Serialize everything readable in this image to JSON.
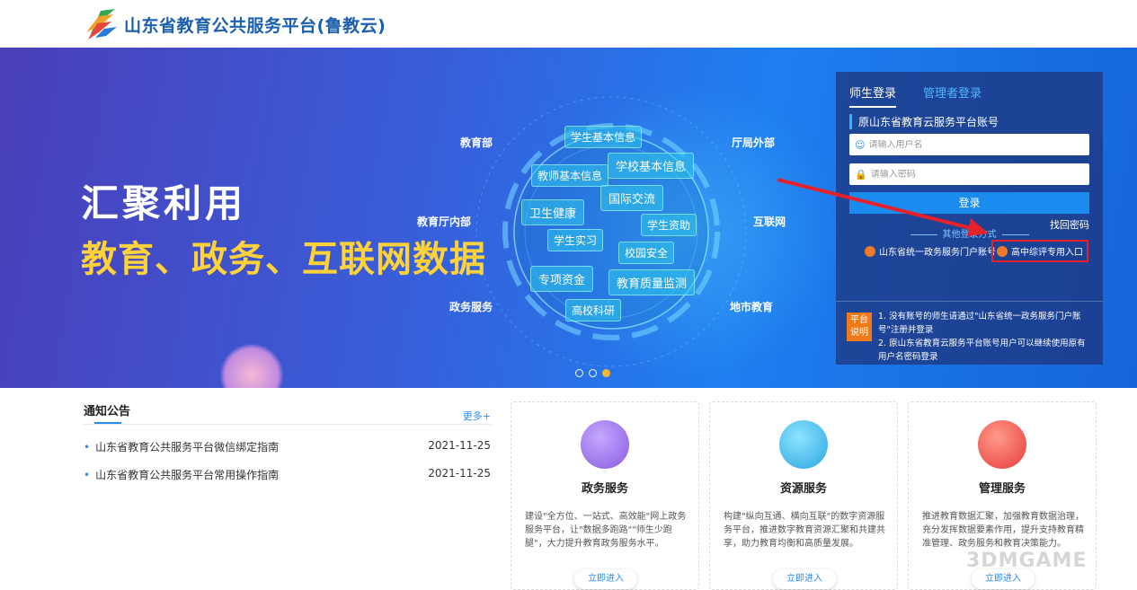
{
  "header": {
    "title": "山东省教育公共服务平台(鲁教云)"
  },
  "banner": {
    "headline": "汇聚利用",
    "subheadline": "教育、政务、互联网数据",
    "spokes": [
      "教育部",
      "厅局外部",
      "教育厅内部",
      "互联网",
      "政务服务",
      "地市教育"
    ],
    "tags": [
      "学生基本信息",
      "教师基本信息",
      "学校基本信息",
      "卫生健康",
      "国际交流",
      "学生资助",
      "学生实习",
      "校园安全",
      "专项资金",
      "教育质量监测",
      "高校科研"
    ],
    "carousel": {
      "total": 3,
      "active": 3
    }
  },
  "login": {
    "tabs": [
      "师生登录",
      "管理者登录"
    ],
    "subtitle": "原山东省教育云服务平台账号",
    "username_placeholder": "请输入用户名",
    "password_placeholder": "请输入密码",
    "login_button": "登录",
    "forgot": "找回密码",
    "other_label": "其他登录方式",
    "alt_gov": "山东省统一政务服务门户账号",
    "alt_highschool": "高中综评专用入口",
    "note_badge": "平台说明",
    "notes": [
      "1. 没有账号的师生请通过\"山东省统一政务服务门户账号\"注册并登录",
      "2. 原山东省教育云服务平台账号用户可以继续使用原有用户名密码登录"
    ]
  },
  "notice": {
    "title": "通知公告",
    "more": "更多+",
    "items": [
      {
        "title": "山东省教育公共服务平台微信绑定指南",
        "date": "2021-11-25"
      },
      {
        "title": "山东省教育公共服务平台常用操作指南",
        "date": "2021-11-25"
      }
    ]
  },
  "cards": [
    {
      "title": "政务服务",
      "desc": "建设\"全方位、一站式、高效能\"网上政务服务平台，让\"数据多跑路\"\"师生少跑腿\"，大力提升教育政务服务水平。",
      "button": "立即进入",
      "color": "#9a6ae8",
      "icon": "users-icon"
    },
    {
      "title": "资源服务",
      "desc": "构建\"纵向互通、横向互联\"的数字资源服务平台，推进数字教育资源汇聚和共建共享，助力教育均衡和高质量发展。",
      "button": "立即进入",
      "color": "#3ab8e8",
      "icon": "briefcase-icon"
    },
    {
      "title": "管理服务",
      "desc": "推进教育数据汇聚，加强教育数据治理，充分发挥数据要素作用，提升支持教育精准管理、政务服务和教育决策能力。",
      "button": "立即进入",
      "color": "#f0504a",
      "icon": "bulb-icon"
    }
  ],
  "watermark": "3DMGAME"
}
